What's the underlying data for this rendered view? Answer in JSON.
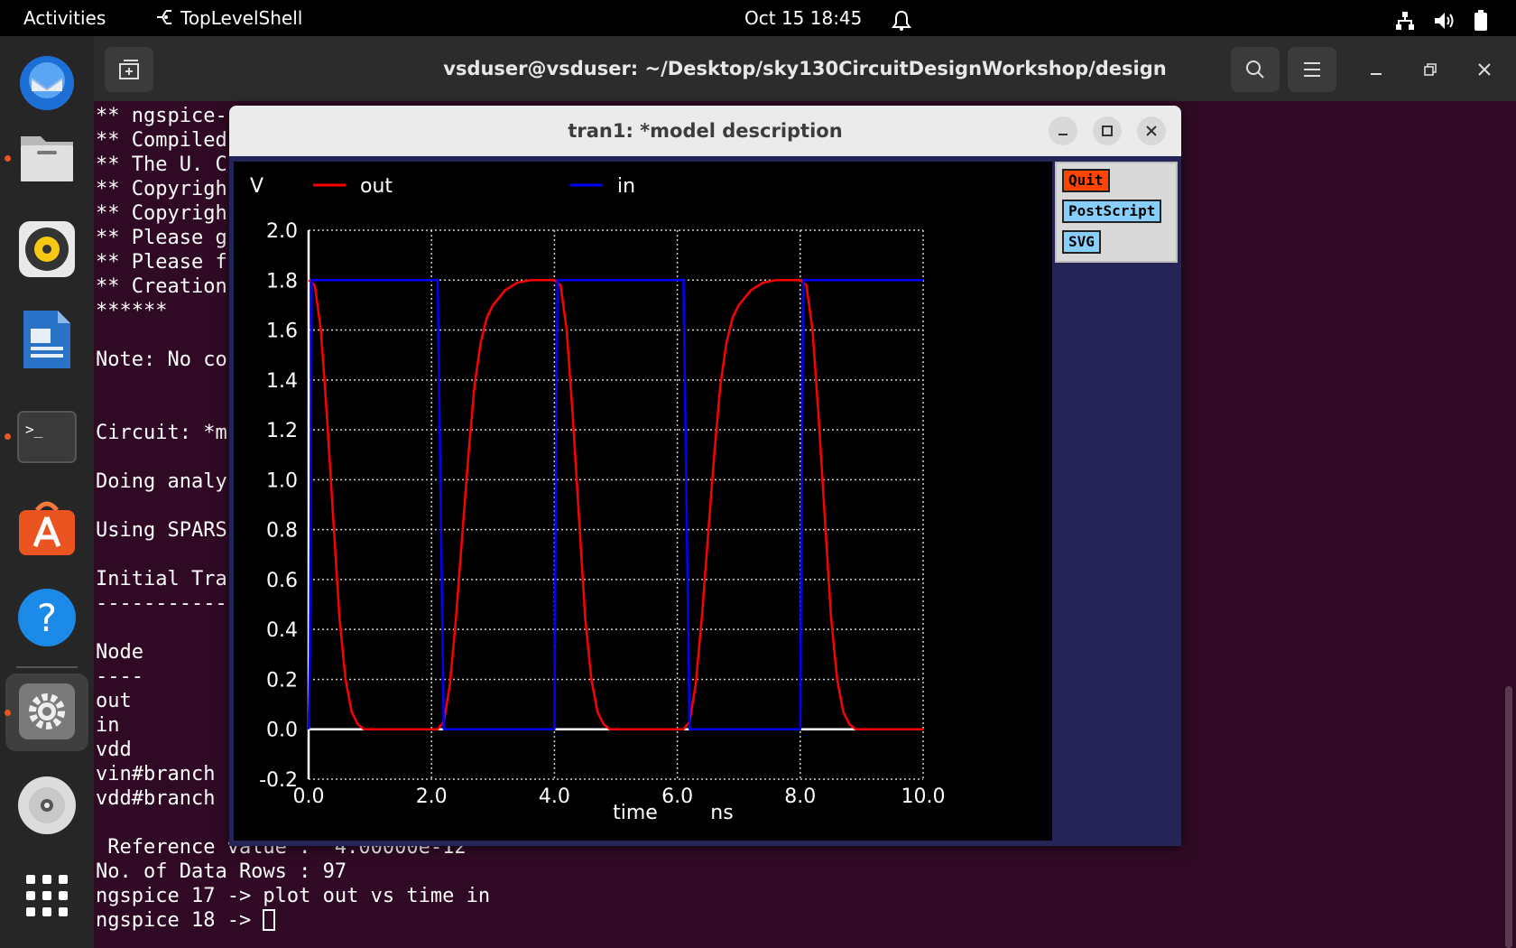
{
  "topbar": {
    "activities": "Activities",
    "app_name": "TopLevelShell",
    "clock": "Oct 15  18:45"
  },
  "terminal": {
    "title": "vsduser@vsduser: ~/Desktop/sky130CircuitDesignWorkshop/design",
    "lines": [
      "** ngspice-",
      "** Compiled",
      "** The U. C",
      "** Copyrigh",
      "** Copyrigh",
      "** Please g",
      "** Please f",
      "** Creation",
      "******",
      "",
      "Note: No co",
      "",
      "",
      "Circuit: *m",
      "",
      "Doing analy",
      "",
      "Using SPARS",
      "",
      "Initial Tra",
      "-----------",
      "",
      "Node",
      "----",
      "out",
      "in",
      "vdd",
      "vin#branch",
      "vdd#branch",
      "",
      " Reference value :  4.00000e-12",
      "No. of Data Rows : 97",
      "ngspice 17 -> plot out vs time in",
      "ngspice 18 -> "
    ]
  },
  "plot_window": {
    "title": "tran1: *model description",
    "buttons": {
      "quit": "Quit",
      "postscript": "PostScript",
      "svg": "SVG"
    }
  },
  "chart_data": {
    "type": "line",
    "ylabel": "V",
    "xlabel": "time",
    "xunit": "ns",
    "xlim": [
      0,
      10
    ],
    "ylim": [
      -0.2,
      2.0
    ],
    "x_ticks": [
      "0.0",
      "2.0",
      "4.0",
      "6.0",
      "8.0",
      "10.0"
    ],
    "y_ticks": [
      "-0.2",
      "0.0",
      "0.2",
      "0.4",
      "0.6",
      "0.8",
      "1.0",
      "1.2",
      "1.4",
      "1.6",
      "1.8",
      "2.0"
    ],
    "grid": true,
    "legend": "top",
    "series": [
      {
        "name": "out",
        "color": "#ff0000",
        "x": [
          0,
          0.1,
          0.2,
          0.3,
          0.4,
          0.5,
          0.6,
          0.7,
          0.8,
          0.9,
          1.0,
          2.0,
          2.1,
          2.2,
          2.3,
          2.4,
          2.5,
          2.6,
          2.7,
          2.8,
          2.9,
          3.0,
          3.2,
          3.4,
          3.6,
          3.8,
          4.0,
          4.1,
          4.2,
          4.3,
          4.4,
          4.5,
          4.6,
          4.7,
          4.8,
          4.9,
          5.0,
          6.0,
          6.1,
          6.2,
          6.3,
          6.4,
          6.5,
          6.6,
          6.7,
          6.8,
          6.9,
          7.0,
          7.2,
          7.4,
          7.6,
          7.8,
          8.0,
          8.1,
          8.2,
          8.3,
          8.4,
          8.5,
          8.6,
          8.7,
          8.8,
          8.9,
          9.0,
          10.0
        ],
        "y": [
          1.8,
          1.78,
          1.6,
          1.25,
          0.85,
          0.45,
          0.2,
          0.07,
          0.02,
          0.0,
          0.0,
          0.0,
          0.0,
          0.03,
          0.18,
          0.45,
          0.78,
          1.1,
          1.38,
          1.55,
          1.65,
          1.7,
          1.76,
          1.79,
          1.8,
          1.8,
          1.8,
          1.78,
          1.6,
          1.25,
          0.85,
          0.45,
          0.2,
          0.07,
          0.02,
          0.0,
          0.0,
          0.0,
          0.0,
          0.03,
          0.18,
          0.45,
          0.78,
          1.1,
          1.38,
          1.55,
          1.65,
          1.7,
          1.76,
          1.79,
          1.8,
          1.8,
          1.8,
          1.78,
          1.6,
          1.25,
          0.85,
          0.45,
          0.2,
          0.07,
          0.02,
          0.0,
          0.0,
          0.0
        ]
      },
      {
        "name": "in",
        "color": "#0000ff",
        "x": [
          0,
          0.02,
          0.05,
          2.1,
          2.15,
          2.2,
          4.0,
          4.02,
          4.05,
          6.1,
          6.15,
          6.2,
          8.0,
          8.02,
          8.05,
          10.0
        ],
        "y": [
          0.0,
          0.3,
          1.8,
          1.8,
          0.9,
          0.0,
          0.0,
          0.9,
          1.8,
          1.8,
          0.9,
          0.0,
          0.0,
          0.9,
          1.8,
          1.8
        ]
      }
    ]
  }
}
